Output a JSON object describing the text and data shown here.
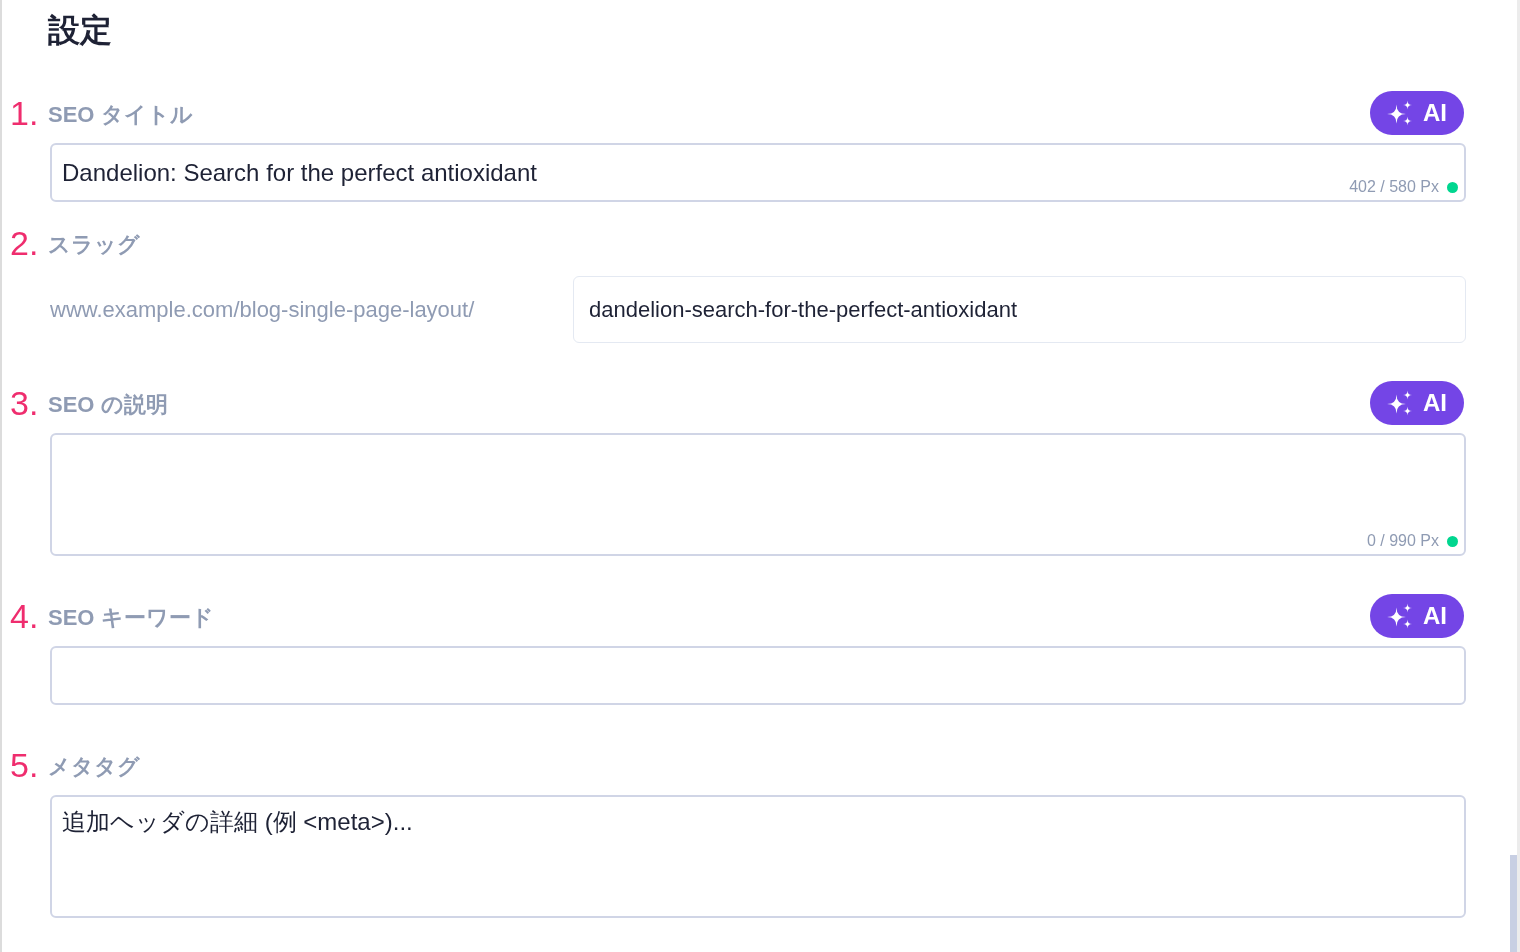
{
  "title": "設定",
  "fields": [
    {
      "kind": "input",
      "number": "1.",
      "label": "SEO タイトル",
      "ai_button": "AI",
      "value": "Dandelion: Search for the perfect antioxidant",
      "counter": "402 / 580 Px"
    },
    {
      "kind": "slug",
      "number": "2.",
      "label": "スラッグ",
      "prefix": "www.example.com/blog-single-page-layout/",
      "value": "dandelion-search-for-the-perfect-antioxidant"
    },
    {
      "kind": "textarea",
      "number": "3.",
      "label": "SEO の説明",
      "ai_button": "AI",
      "counter": "0 / 990 Px"
    },
    {
      "kind": "input",
      "number": "4.",
      "label": "SEO キーワード",
      "ai_button": "AI"
    },
    {
      "kind": "textarea",
      "number": "5.",
      "label": "メタタグ",
      "placeholder": "追加ヘッダの詳細 (例 <meta>)..."
    }
  ]
}
